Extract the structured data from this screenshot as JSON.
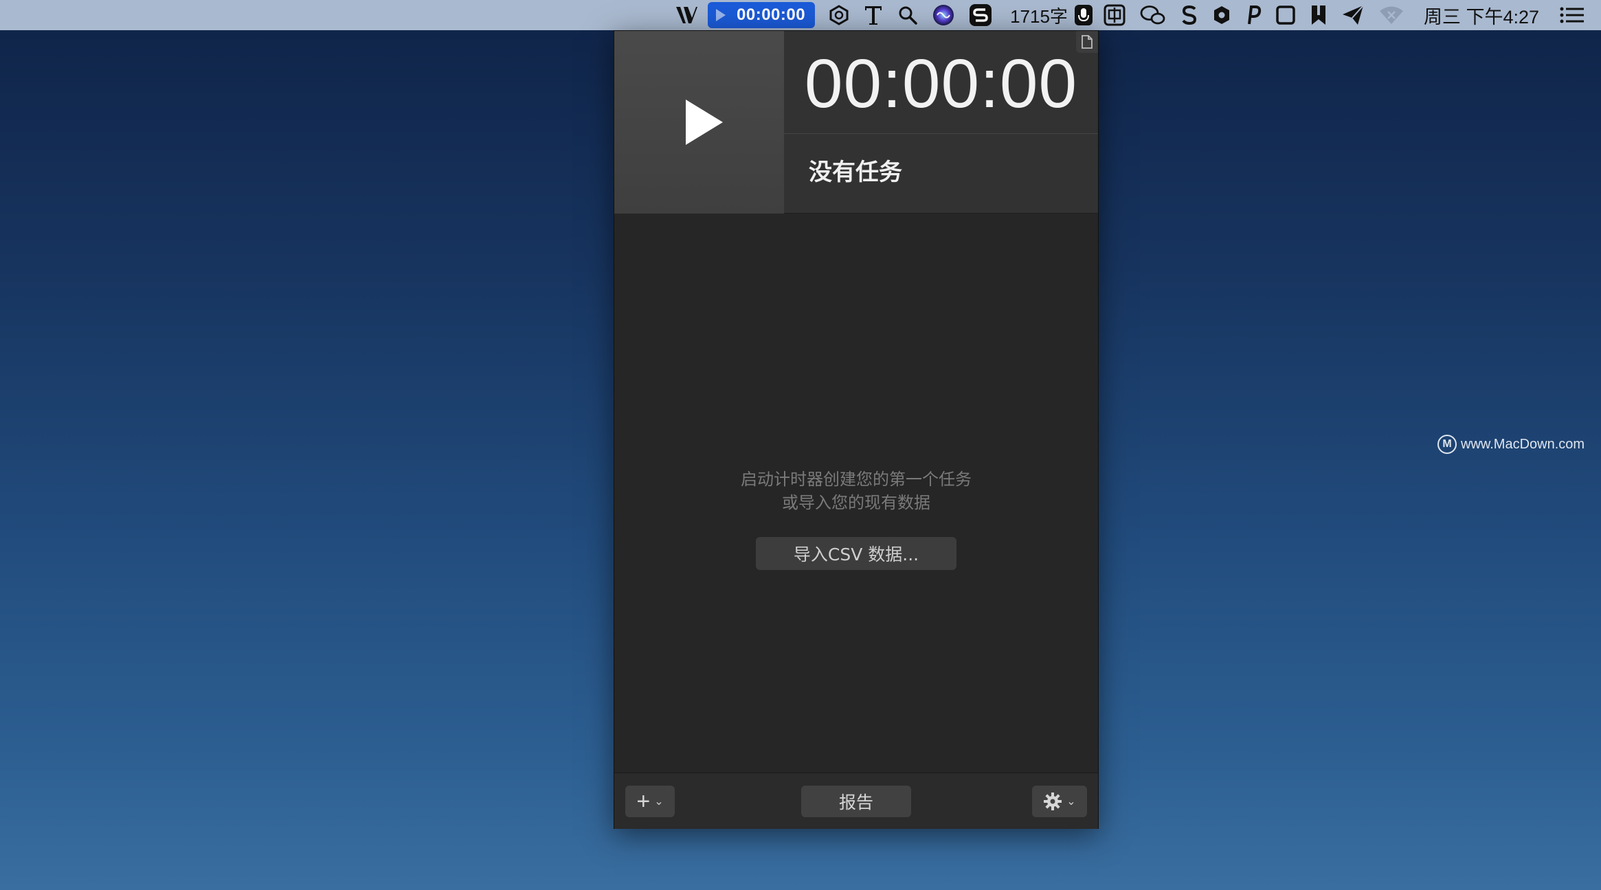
{
  "menubar": {
    "timer": "00:00:00",
    "word_count": "1715字",
    "clock": "周三 下午4:27",
    "icons": [
      "app-v-icon",
      "timer-play-icon",
      "shield-badge-icon",
      "text-t-icon",
      "search-icon",
      "siri-icon",
      "s-logo-icon",
      "mic-icon",
      "input-method-icon",
      "wechat-icon",
      "s-letter-icon",
      "hexagon-icon",
      "p-icon",
      "square-icon",
      "bookmark-icon",
      "paper-plane-icon",
      "wifi-icon",
      "list-icon"
    ]
  },
  "popover": {
    "timer": "00:00:00",
    "task_name": "没有任务",
    "empty_line1": "启动计时器创建您的第一个任务",
    "empty_line2": "或导入您的现有数据",
    "import_label": "导入CSV 数据...",
    "add_label": "+",
    "report_label": "报告"
  },
  "watermark": {
    "logo": "M",
    "text": "www.MacDown.com"
  }
}
